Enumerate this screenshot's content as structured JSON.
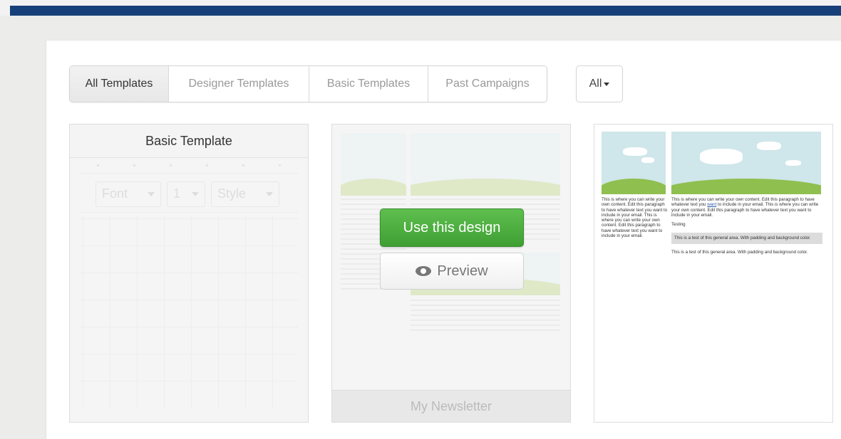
{
  "tabs": [
    {
      "label": "All Templates",
      "active": true
    },
    {
      "label": "Designer Templates",
      "active": false
    },
    {
      "label": "Basic Templates",
      "active": false
    },
    {
      "label": "Past Campaigns",
      "active": false
    }
  ],
  "filter": {
    "label": "All"
  },
  "cards": {
    "basic": {
      "title": "Basic Template",
      "toolbar": {
        "font": "Font",
        "size": "1",
        "style": "Style"
      }
    },
    "newsletter": {
      "use_button": "Use this design",
      "preview_button": "Preview",
      "footer": "My Newsletter"
    },
    "preview": {
      "col_a": "This is where you can write your own content. Edit this paragraph to have whatever text you want to include in your email. This is where you can write your own content. Edit this paragraph to have whatever text you want to include in your email.",
      "col_b_before": "This is where you can write your own content. Edit this paragraph to have whatever text you ",
      "col_b_link": "want",
      "col_b_after": " to include in your email. This is where you can write your own content. Edit this paragraph to have whatever text you want to include in your email.",
      "subhead": "Testing",
      "highlight": "This is a test of this general area. With padding and background color.",
      "footer_text": "This is a test of this general area. With padding and background color."
    }
  },
  "colors": {
    "accent_bar": "#17407a",
    "use_button": "#4caf3e"
  }
}
